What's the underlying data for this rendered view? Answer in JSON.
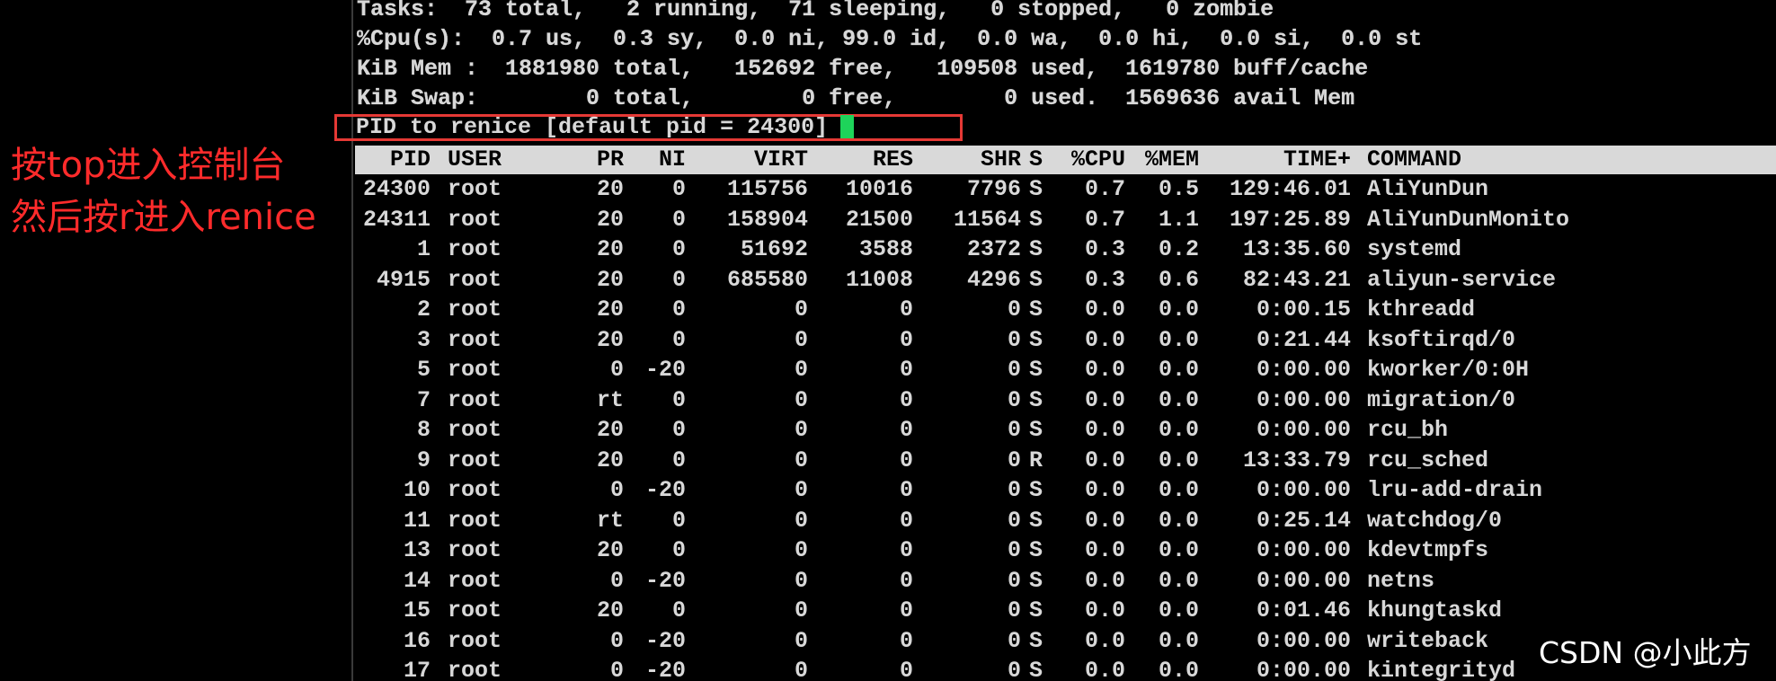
{
  "summary": {
    "tasks": "Tasks:  73 total,   2 running,  71 sleeping,   0 stopped,   0 zombie",
    "cpu": "%Cpu(s):  0.7 us,  0.3 sy,  0.0 ni, 99.0 id,  0.0 wa,  0.0 hi,  0.0 si,  0.0 st",
    "mem": "KiB Mem :  1881980 total,   152692 free,   109508 used,  1619780 buff/cache",
    "swap": "KiB Swap:        0 total,        0 free,        0 used.  1569636 avail Mem"
  },
  "prompt": {
    "text": "PID to renice [default pid = 24300]",
    "cursor_color": "#1ed45a",
    "box_color": "#e53935"
  },
  "columns": {
    "pid": "PID",
    "user": "USER",
    "pr": "PR",
    "ni": "NI",
    "virt": "VIRT",
    "res": "RES",
    "shr": "SHR",
    "s": "S",
    "cpu": "%CPU",
    "mem": "%MEM",
    "time": "TIME+",
    "command": "COMMAND"
  },
  "processes": [
    {
      "pid": "24300",
      "user": "root",
      "pr": "20",
      "ni": "0",
      "virt": "115756",
      "res": "10016",
      "shr": "7796",
      "s": "S",
      "cpu": "0.7",
      "mem": "0.5",
      "time": "129:46.01",
      "command": "AliYunDun"
    },
    {
      "pid": "24311",
      "user": "root",
      "pr": "20",
      "ni": "0",
      "virt": "158904",
      "res": "21500",
      "shr": "11564",
      "s": "S",
      "cpu": "0.7",
      "mem": "1.1",
      "time": "197:25.89",
      "command": "AliYunDunMonito"
    },
    {
      "pid": "1",
      "user": "root",
      "pr": "20",
      "ni": "0",
      "virt": "51692",
      "res": "3588",
      "shr": "2372",
      "s": "S",
      "cpu": "0.3",
      "mem": "0.2",
      "time": "13:35.60",
      "command": "systemd"
    },
    {
      "pid": "4915",
      "user": "root",
      "pr": "20",
      "ni": "0",
      "virt": "685580",
      "res": "11008",
      "shr": "4296",
      "s": "S",
      "cpu": "0.3",
      "mem": "0.6",
      "time": "82:43.21",
      "command": "aliyun-service"
    },
    {
      "pid": "2",
      "user": "root",
      "pr": "20",
      "ni": "0",
      "virt": "0",
      "res": "0",
      "shr": "0",
      "s": "S",
      "cpu": "0.0",
      "mem": "0.0",
      "time": "0:00.15",
      "command": "kthreadd"
    },
    {
      "pid": "3",
      "user": "root",
      "pr": "20",
      "ni": "0",
      "virt": "0",
      "res": "0",
      "shr": "0",
      "s": "S",
      "cpu": "0.0",
      "mem": "0.0",
      "time": "0:21.44",
      "command": "ksoftirqd/0"
    },
    {
      "pid": "5",
      "user": "root",
      "pr": "0",
      "ni": "-20",
      "virt": "0",
      "res": "0",
      "shr": "0",
      "s": "S",
      "cpu": "0.0",
      "mem": "0.0",
      "time": "0:00.00",
      "command": "kworker/0:0H"
    },
    {
      "pid": "7",
      "user": "root",
      "pr": "rt",
      "ni": "0",
      "virt": "0",
      "res": "0",
      "shr": "0",
      "s": "S",
      "cpu": "0.0",
      "mem": "0.0",
      "time": "0:00.00",
      "command": "migration/0"
    },
    {
      "pid": "8",
      "user": "root",
      "pr": "20",
      "ni": "0",
      "virt": "0",
      "res": "0",
      "shr": "0",
      "s": "S",
      "cpu": "0.0",
      "mem": "0.0",
      "time": "0:00.00",
      "command": "rcu_bh"
    },
    {
      "pid": "9",
      "user": "root",
      "pr": "20",
      "ni": "0",
      "virt": "0",
      "res": "0",
      "shr": "0",
      "s": "R",
      "cpu": "0.0",
      "mem": "0.0",
      "time": "13:33.79",
      "command": "rcu_sched"
    },
    {
      "pid": "10",
      "user": "root",
      "pr": "0",
      "ni": "-20",
      "virt": "0",
      "res": "0",
      "shr": "0",
      "s": "S",
      "cpu": "0.0",
      "mem": "0.0",
      "time": "0:00.00",
      "command": "lru-add-drain"
    },
    {
      "pid": "11",
      "user": "root",
      "pr": "rt",
      "ni": "0",
      "virt": "0",
      "res": "0",
      "shr": "0",
      "s": "S",
      "cpu": "0.0",
      "mem": "0.0",
      "time": "0:25.14",
      "command": "watchdog/0"
    },
    {
      "pid": "13",
      "user": "root",
      "pr": "20",
      "ni": "0",
      "virt": "0",
      "res": "0",
      "shr": "0",
      "s": "S",
      "cpu": "0.0",
      "mem": "0.0",
      "time": "0:00.00",
      "command": "kdevtmpfs"
    },
    {
      "pid": "14",
      "user": "root",
      "pr": "0",
      "ni": "-20",
      "virt": "0",
      "res": "0",
      "shr": "0",
      "s": "S",
      "cpu": "0.0",
      "mem": "0.0",
      "time": "0:00.00",
      "command": "netns"
    },
    {
      "pid": "15",
      "user": "root",
      "pr": "20",
      "ni": "0",
      "virt": "0",
      "res": "0",
      "shr": "0",
      "s": "S",
      "cpu": "0.0",
      "mem": "0.0",
      "time": "0:01.46",
      "command": "khungtaskd"
    },
    {
      "pid": "16",
      "user": "root",
      "pr": "0",
      "ni": "-20",
      "virt": "0",
      "res": "0",
      "shr": "0",
      "s": "S",
      "cpu": "0.0",
      "mem": "0.0",
      "time": "0:00.00",
      "command": "writeback"
    },
    {
      "pid": "17",
      "user": "root",
      "pr": "0",
      "ni": "-20",
      "virt": "0",
      "res": "0",
      "shr": "0",
      "s": "S",
      "cpu": "0.0",
      "mem": "0.0",
      "time": "0:00.00",
      "command": "kintegrityd"
    }
  ],
  "annotation": {
    "line1": "按top进入控制台",
    "line2": "然后按r进入renice",
    "color": "#ff2b2b"
  },
  "watermark": "CSDN @小此方"
}
